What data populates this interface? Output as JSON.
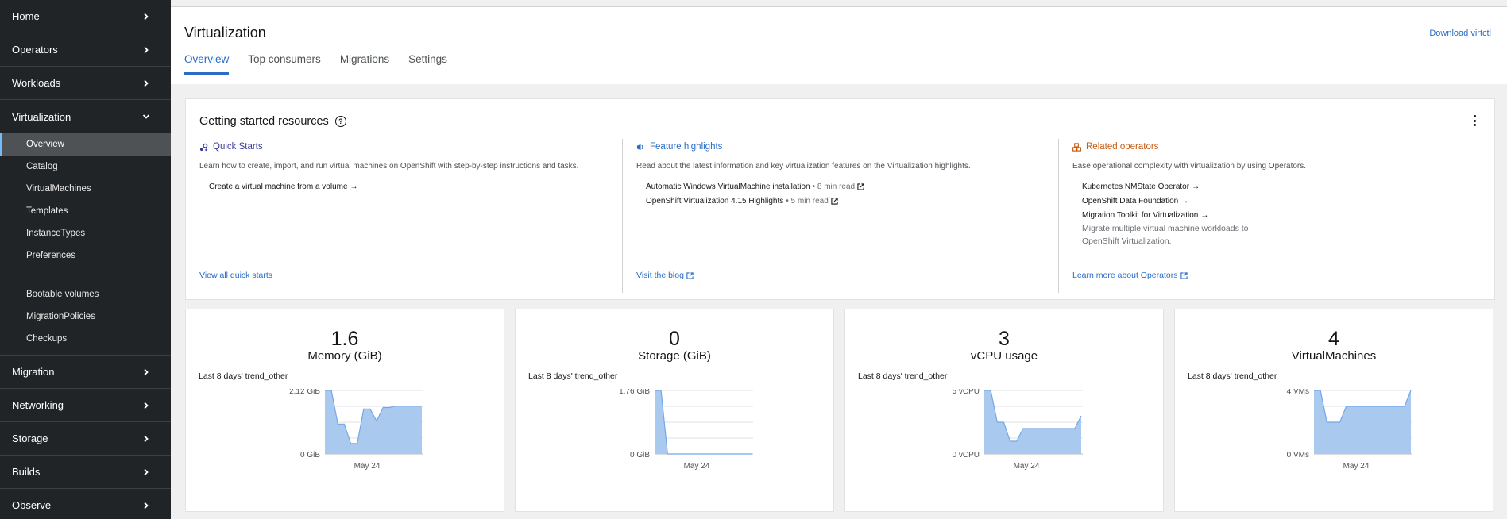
{
  "sidebar": {
    "groups_top": [
      {
        "label": "Home"
      },
      {
        "label": "Operators"
      },
      {
        "label": "Workloads"
      }
    ],
    "virtualization": {
      "label": "Virtualization",
      "items": [
        "Overview",
        "Catalog",
        "VirtualMachines",
        "Templates",
        "InstanceTypes",
        "Preferences"
      ],
      "items2": [
        "Bootable volumes",
        "MigrationPolicies",
        "Checkups"
      ]
    },
    "groups_bottom": [
      {
        "label": "Migration"
      },
      {
        "label": "Networking"
      },
      {
        "label": "Storage"
      },
      {
        "label": "Builds"
      },
      {
        "label": "Observe"
      }
    ]
  },
  "header": {
    "title": "Virtualization",
    "download_link": "Download virtctl",
    "tabs": [
      "Overview",
      "Top consumers",
      "Migrations",
      "Settings"
    ],
    "active_tab": "Overview"
  },
  "getting_started": {
    "title": "Getting started resources",
    "quick_starts": {
      "title": "Quick Starts",
      "description": "Learn how to create, import, and run virtual machines on OpenShift with step-by-step instructions and tasks.",
      "links": [
        "Create a virtual machine from a volume"
      ],
      "footer": "View all quick starts"
    },
    "feature_highlights": {
      "title": "Feature highlights",
      "description": "Read about the latest information and key virtualization features on the Virtualization highlights.",
      "links": [
        {
          "title": "Automatic Windows VirtualMachine installation",
          "meta": " • 8 min read"
        },
        {
          "title": "OpenShift Virtualization 4.15 Highlights",
          "meta": " • 5 min read"
        }
      ],
      "footer": "Visit the blog"
    },
    "related_operators": {
      "title": "Related operators",
      "description": "Ease operational complexity with virtualization by using Operators.",
      "links": [
        "Kubernetes NMState Operator",
        "OpenShift Data Foundation",
        "Migration Toolkit for Virtualization"
      ],
      "note": "Migrate multiple virtual machine workloads to OpenShift Virtualization.",
      "footer": "Learn more about Operators"
    }
  },
  "metrics": [
    {
      "value": "1.6",
      "label": "Memory (GiB)",
      "trend": "Last 8 days' trend_other"
    },
    {
      "value": "0",
      "label": "Storage (GiB)",
      "trend": "Last 8 days' trend_other"
    },
    {
      "value": "3",
      "label": "vCPU usage",
      "trend": "Last 8 days' trend_other"
    },
    {
      "value": "4",
      "label": "VirtualMachines",
      "trend": "Last 8 days' trend_other"
    }
  ],
  "chart_data": [
    {
      "type": "area",
      "title": "Memory (GiB)",
      "y_ticks": [
        "2.12 GiB",
        "0 GiB"
      ],
      "ylim": [
        0,
        2.12
      ],
      "x_label": "May 24",
      "values": [
        2.12,
        2.12,
        1.0,
        1.0,
        0.35,
        0.35,
        1.5,
        1.5,
        1.1,
        1.55,
        1.55,
        1.6,
        1.6,
        1.6,
        1.6,
        1.6
      ]
    },
    {
      "type": "area",
      "title": "Storage (GiB)",
      "y_ticks": [
        "1.76 GiB",
        "0 GiB"
      ],
      "ylim": [
        0,
        1.76
      ],
      "x_label": "May 24",
      "values": [
        1.76,
        1.76,
        0,
        0,
        0,
        0,
        0,
        0,
        0,
        0,
        0,
        0,
        0,
        0,
        0,
        0
      ]
    },
    {
      "type": "area",
      "title": "vCPU usage",
      "y_ticks": [
        "5 vCPU",
        "0 vCPU"
      ],
      "ylim": [
        0,
        5
      ],
      "x_label": "May 24",
      "values": [
        5,
        5,
        2.5,
        2.5,
        1,
        1,
        2,
        2,
        2,
        2,
        2,
        2,
        2,
        2,
        2,
        3
      ]
    },
    {
      "type": "area",
      "title": "VirtualMachines",
      "y_ticks": [
        "4 VMs",
        "0 VMs"
      ],
      "ylim": [
        0,
        4
      ],
      "x_label": "May 24",
      "values": [
        4,
        4,
        2,
        2,
        2,
        3,
        3,
        3,
        3,
        3,
        3,
        3,
        3,
        3,
        3,
        4
      ]
    }
  ],
  "colors": {
    "sidebar_bg": "#212427",
    "accent": "#2b6cc4",
    "area_fill": "#a9c9ef",
    "area_line": "#73a8e8"
  }
}
